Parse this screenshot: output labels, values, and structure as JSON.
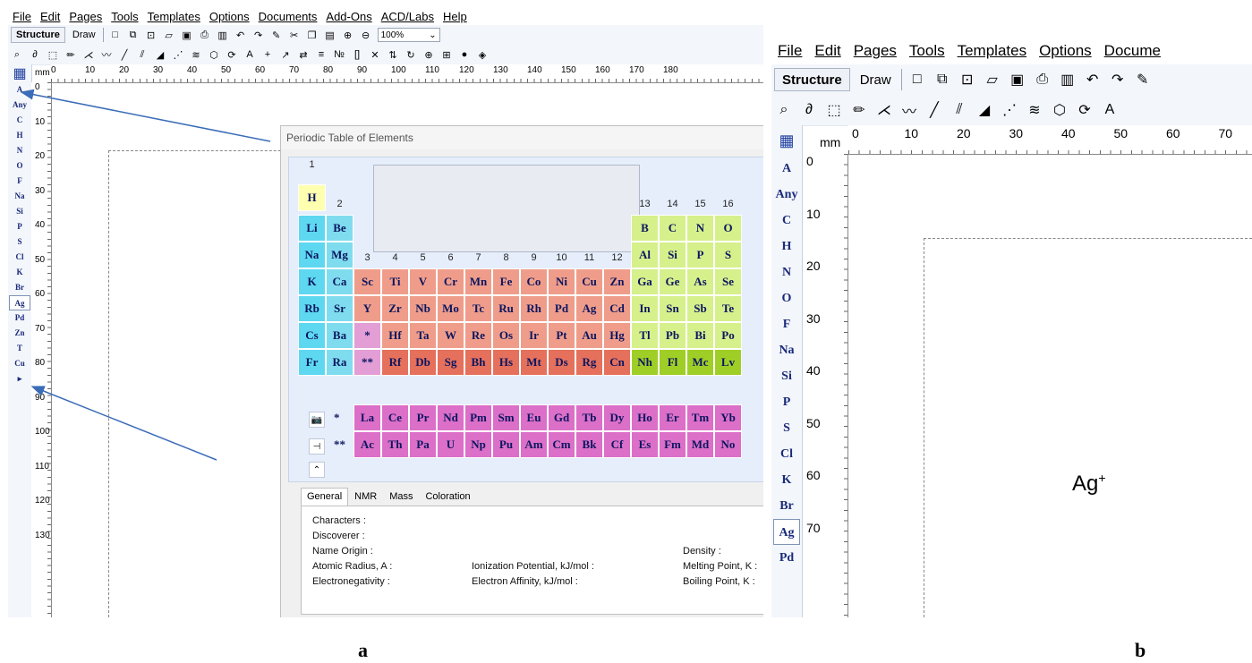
{
  "menu": [
    "File",
    "Edit",
    "Pages",
    "Tools",
    "Templates",
    "Options",
    "Documents",
    "Add-Ons",
    "ACD/Labs",
    "Help"
  ],
  "menu_b": [
    "File",
    "Edit",
    "Pages",
    "Tools",
    "Templates",
    "Options",
    "Docume"
  ],
  "toolbar": {
    "structure_label": "Structure",
    "draw_label": "Draw",
    "zoom_value": "100%"
  },
  "toolbar_icons": [
    "new-page-icon",
    "copy-page-icon",
    "open-icon",
    "folder-icon",
    "save-icon",
    "print-icon",
    "pdf-icon",
    "undo-icon",
    "redo-icon",
    "eraser-icon",
    "cut-icon",
    "copy-icon",
    "paste-icon",
    "zoom-in-icon",
    "zoom-out-icon"
  ],
  "toolbar_icons_b": [
    "new-page-icon",
    "copy-page-icon",
    "open-icon",
    "folder-icon",
    "save-icon",
    "print-icon",
    "pdf-icon",
    "undo-icon",
    "redo-icon",
    "eraser-icon"
  ],
  "draw_icons": [
    "select-icon",
    "lasso-icon",
    "rectangle-select-icon",
    "pencil-icon",
    "chain-icon",
    "wave-chain-icon",
    "single-bond-icon",
    "hash-bond-icon",
    "wedge-bond-icon",
    "dashed-bond-icon",
    "stereo-bond-icon",
    "ring-icon",
    "ring-rotate-icon",
    "atom-label-icon",
    "plus-icon",
    "arrow-icon",
    "reaction-icon",
    "align-icon",
    "numbering-icon",
    "bracket-icon",
    "clean-icon",
    "flip-icon",
    "rotate-icon",
    "center-icon",
    "template-icon",
    "color-icon",
    "3d-icon"
  ],
  "ruler": {
    "unit": "mm",
    "h_labels_a": [
      "0",
      "10",
      "20",
      "30",
      "40",
      "50",
      "60",
      "70",
      "80",
      "90",
      "100",
      "110",
      "120",
      "130",
      "140",
      "150",
      "160",
      "170",
      "180"
    ],
    "v_labels_a": [
      "0",
      "10",
      "20",
      "30",
      "40",
      "50",
      "60",
      "70",
      "80",
      "90",
      "100",
      "110",
      "120",
      "130"
    ],
    "h_labels_b": [
      "0",
      "10",
      "20",
      "30",
      "40",
      "50",
      "60",
      "70"
    ],
    "v_labels_b": [
      "0",
      "10",
      "20",
      "30",
      "40",
      "50",
      "60",
      "70"
    ]
  },
  "left_elements_a": [
    "A",
    "Any",
    "C",
    "H",
    "N",
    "O",
    "F",
    "Na",
    "Si",
    "P",
    "S",
    "Cl",
    "K",
    "Br",
    "Ag",
    "Pd",
    "Zn",
    "T",
    "Cu"
  ],
  "left_elements_b": [
    "A",
    "Any",
    "C",
    "H",
    "N",
    "O",
    "F",
    "Na",
    "Si",
    "P",
    "S",
    "Cl",
    "K",
    "Br",
    "Ag",
    "Pd"
  ],
  "selected_element": "Ag",
  "periodic": {
    "title": "Periodic Table of Elements",
    "group_numbers": [
      "1",
      "2",
      "3",
      "4",
      "5",
      "6",
      "7",
      "8",
      "9",
      "10",
      "11",
      "12",
      "13",
      "14",
      "15",
      "16"
    ],
    "rows": [
      [
        [
          "H",
          0,
          "s"
        ]
      ],
      [
        [
          "Li",
          0,
          "a"
        ],
        [
          "Be",
          1,
          "e"
        ],
        [
          "B",
          12,
          "p"
        ],
        [
          "C",
          13,
          "p"
        ],
        [
          "N",
          14,
          "p"
        ],
        [
          "O",
          15,
          "p"
        ]
      ],
      [
        [
          "Na",
          0,
          "a"
        ],
        [
          "Mg",
          1,
          "e"
        ],
        [
          "Al",
          12,
          "p"
        ],
        [
          "Si",
          13,
          "p"
        ],
        [
          "P",
          14,
          "p"
        ],
        [
          "S",
          15,
          "p"
        ]
      ],
      [
        [
          "K",
          0,
          "a"
        ],
        [
          "Ca",
          1,
          "e"
        ],
        [
          "Sc",
          2,
          "t"
        ],
        [
          "Ti",
          3,
          "t"
        ],
        [
          "V",
          4,
          "t"
        ],
        [
          "Cr",
          5,
          "t"
        ],
        [
          "Mn",
          6,
          "t"
        ],
        [
          "Fe",
          7,
          "t"
        ],
        [
          "Co",
          8,
          "t"
        ],
        [
          "Ni",
          9,
          "t"
        ],
        [
          "Cu",
          10,
          "t"
        ],
        [
          "Zn",
          11,
          "t"
        ],
        [
          "Ga",
          12,
          "p"
        ],
        [
          "Ge",
          13,
          "p"
        ],
        [
          "As",
          14,
          "p"
        ],
        [
          "Se",
          15,
          "p"
        ]
      ],
      [
        [
          "Rb",
          0,
          "a"
        ],
        [
          "Sr",
          1,
          "e"
        ],
        [
          "Y",
          2,
          "t"
        ],
        [
          "Zr",
          3,
          "t"
        ],
        [
          "Nb",
          4,
          "t"
        ],
        [
          "Mo",
          5,
          "t"
        ],
        [
          "Tc",
          6,
          "t"
        ],
        [
          "Ru",
          7,
          "t"
        ],
        [
          "Rh",
          8,
          "t"
        ],
        [
          "Pd",
          9,
          "t"
        ],
        [
          "Ag",
          10,
          "t"
        ],
        [
          "Cd",
          11,
          "t"
        ],
        [
          "In",
          12,
          "p"
        ],
        [
          "Sn",
          13,
          "p"
        ],
        [
          "Sb",
          14,
          "p"
        ],
        [
          "Te",
          15,
          "p"
        ]
      ],
      [
        [
          "Cs",
          0,
          "a"
        ],
        [
          "Ba",
          1,
          "e"
        ],
        [
          "*",
          2,
          "l"
        ],
        [
          "Hf",
          3,
          "t"
        ],
        [
          "Ta",
          4,
          "t"
        ],
        [
          "W",
          5,
          "t"
        ],
        [
          "Re",
          6,
          "t"
        ],
        [
          "Os",
          7,
          "t"
        ],
        [
          "Ir",
          8,
          "t"
        ],
        [
          "Pt",
          9,
          "t"
        ],
        [
          "Au",
          10,
          "t"
        ],
        [
          "Hg",
          11,
          "t"
        ],
        [
          "Tl",
          12,
          "p"
        ],
        [
          "Pb",
          13,
          "p"
        ],
        [
          "Bi",
          14,
          "p"
        ],
        [
          "Po",
          15,
          "p"
        ]
      ],
      [
        [
          "Fr",
          0,
          "a"
        ],
        [
          "Ra",
          1,
          "e"
        ],
        [
          "**",
          2,
          "l"
        ],
        [
          "Rf",
          3,
          "h"
        ],
        [
          "Db",
          4,
          "h"
        ],
        [
          "Sg",
          5,
          "h"
        ],
        [
          "Bh",
          6,
          "h"
        ],
        [
          "Hs",
          7,
          "h"
        ],
        [
          "Mt",
          8,
          "h"
        ],
        [
          "Ds",
          9,
          "h"
        ],
        [
          "Rg",
          10,
          "h"
        ],
        [
          "Cn",
          11,
          "h"
        ],
        [
          "Nh",
          12,
          "q"
        ],
        [
          "Fl",
          13,
          "q"
        ],
        [
          "Mc",
          14,
          "q"
        ],
        [
          "Lv",
          15,
          "q"
        ]
      ]
    ],
    "lanthanides": {
      "marker": "*",
      "elements": [
        "La",
        "Ce",
        "Pr",
        "Nd",
        "Pm",
        "Sm",
        "Eu",
        "Gd",
        "Tb",
        "Dy",
        "Ho",
        "Er",
        "Tm",
        "Yb"
      ]
    },
    "actinides": {
      "marker": "**",
      "elements": [
        "Ac",
        "Th",
        "Pa",
        "U",
        "Np",
        "Pu",
        "Am",
        "Cm",
        "Bk",
        "Cf",
        "Es",
        "Fm",
        "Md",
        "No"
      ]
    },
    "tabs": [
      "General",
      "NMR",
      "Mass",
      "Coloration"
    ],
    "props": {
      "characters": "Characters :",
      "discoverer": "Discoverer :",
      "name_origin": "Name Origin :",
      "atomic_radius": "Atomic Radius, A :",
      "electronegativity": "Electronegativity :",
      "ionization": "Ionization Potential, kJ/mol :",
      "electron_affinity": "Electron Affinity, kJ/mol :",
      "density": "Density :",
      "melting": "Melting Point, K :",
      "boiling": "Boiling Point, K :"
    }
  },
  "canvas_b": {
    "ion": "Ag",
    "charge": "+"
  },
  "labels": {
    "a": "a",
    "b": "b"
  },
  "colors": {
    "s": "#ffffb0",
    "a": "#5ed8f0",
    "e": "#7fdcee",
    "t": "#ef9d8a",
    "l": "#e39ed6",
    "h": "#e5705c",
    "p": "#d6f08c",
    "q": "#9fce27",
    "f": "#dc6fc8",
    "arrow": "#3a6cb8"
  }
}
